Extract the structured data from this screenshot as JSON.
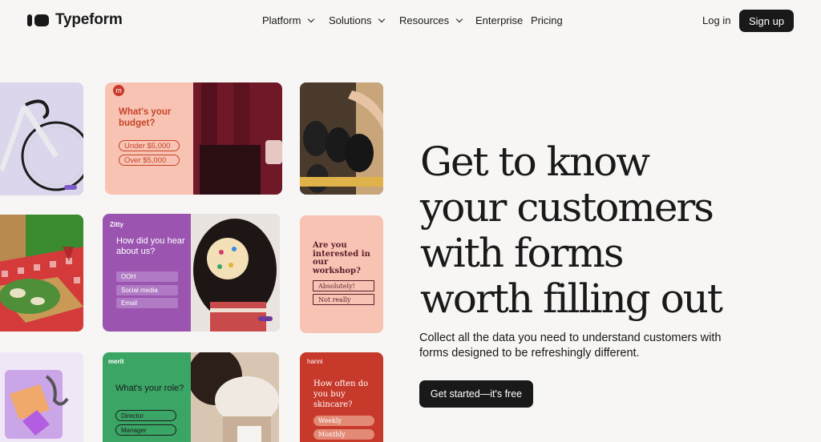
{
  "header": {
    "logo_text": "Typeform",
    "nav": [
      {
        "label": "Platform",
        "has_dropdown": true
      },
      {
        "label": "Solutions",
        "has_dropdown": true
      },
      {
        "label": "Resources",
        "has_dropdown": true
      },
      {
        "label": "Enterprise",
        "has_dropdown": false
      },
      {
        "label": "Pricing",
        "has_dropdown": false
      }
    ],
    "login_label": "Log in",
    "signup_label": "Sign up"
  },
  "hero": {
    "title_lines": [
      "Get to know",
      "your customers",
      "with forms",
      "worth filling out"
    ],
    "subtitle": "Collect all the data you need to understand customers with forms designed to be refreshingly different.",
    "cta_label": "Get started—it's free"
  },
  "cards": {
    "budget": {
      "question": "What's your budget?",
      "options": [
        "Under $5,000",
        "Over $5,000"
      ],
      "logo_letter": "m"
    },
    "zitty": {
      "brand": "Zitty",
      "question": "How did you hear about us?",
      "options": [
        "OOH",
        "Social media",
        "Email"
      ]
    },
    "workshop": {
      "question": "Are you interested in our workshop?",
      "options": [
        "Absolutely!",
        "Not really"
      ]
    },
    "merit": {
      "brand": "merit",
      "question": "What's your role?",
      "options": [
        "Director",
        "Manager"
      ]
    },
    "hanni": {
      "brand": "hanni",
      "question": "How often do you buy skincare?",
      "options": [
        "Weekly",
        "Monthly"
      ]
    }
  },
  "colors": {
    "background": "#f7f6f4",
    "dark": "#191919",
    "peach": "#f9c3b4",
    "purple": "#9b55b0",
    "green": "#3aa565",
    "red": "#c7392b"
  },
  "icons": {
    "chevron": "chevron-down-icon",
    "logo": "typeform-logo-icon"
  }
}
